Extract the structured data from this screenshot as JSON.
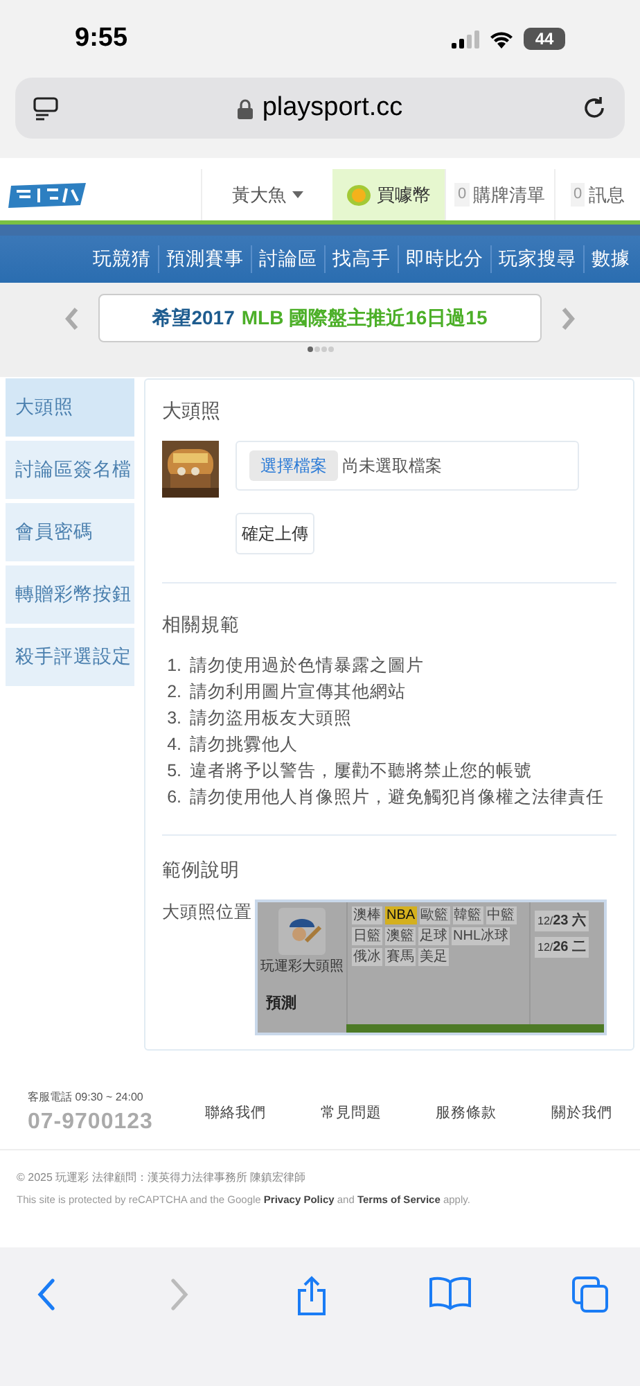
{
  "status_bar": {
    "time": "9:55",
    "battery": "44"
  },
  "browser": {
    "url": "playsport.cc"
  },
  "header": {
    "user": "黃大魚",
    "coin_button": "買噱幣",
    "cart": {
      "count": "0",
      "label": "購牌清單"
    },
    "messages": {
      "count": "0",
      "label": "訊息"
    }
  },
  "nav": [
    "玩競猜",
    "預測賽事",
    "討論區",
    "找高手",
    "即時比分",
    "玩家搜尋",
    "數據"
  ],
  "banner": {
    "prefix": "希望2017",
    "highlight": "MLB 國際盤主推近16日過15",
    "dots": [
      {
        "selected": true
      },
      {
        "selected": false
      },
      {
        "selected": false
      },
      {
        "selected": false
      }
    ]
  },
  "sidebar": [
    {
      "label": "大頭照",
      "selected": true
    },
    {
      "label": "討論區簽名檔",
      "selected": false
    },
    {
      "label": "會員密碼",
      "selected": false
    },
    {
      "label": "轉贈彩幣按鈕",
      "selected": false
    },
    {
      "label": "殺手評選設定",
      "selected": false
    }
  ],
  "avatar_section": {
    "title": "大頭照",
    "file_button": "選擇檔案",
    "file_status": "尚未選取檔案",
    "upload_button": "確定上傳"
  },
  "rules": {
    "title": "相關規範",
    "items": [
      {
        "number": "1.",
        "text": "請勿使用過於色情暴露之圖片"
      },
      {
        "number": "2.",
        "text": "請勿利用圖片宣傳其他網站"
      },
      {
        "number": "3.",
        "text": "請勿盜用板友大頭照"
      },
      {
        "number": "4.",
        "text": "請勿挑釁他人"
      },
      {
        "number": "5.",
        "text": "違者將予以警告，屢勸不聽將禁止您的帳號"
      },
      {
        "number": "6.",
        "text": "請勿使用他人肖像照片，避免觸犯肖像權之法律責任"
      }
    ]
  },
  "example": {
    "title": "範例說明",
    "label": "大頭照位置",
    "screenshot": {
      "caption": "玩運彩大頭照",
      "tags": [
        {
          "text": "澳棒",
          "selected": false
        },
        {
          "text": "NBA",
          "selected": true
        },
        {
          "text": "歐籃",
          "selected": false
        },
        {
          "text": "韓籃",
          "selected": false
        },
        {
          "text": "中籃",
          "selected": false
        },
        {
          "text": "日籃",
          "selected": false
        },
        {
          "text": "澳籃",
          "selected": false
        },
        {
          "text": "足球",
          "selected": false
        },
        {
          "text": "NHL冰球",
          "selected": false
        },
        {
          "text": "俄冰",
          "selected": false
        },
        {
          "text": "賽馬",
          "selected": false
        },
        {
          "text": "美足",
          "selected": false
        }
      ],
      "dates": [
        {
          "prefix": "12/",
          "day": "23",
          "weekday": "六"
        },
        {
          "prefix": "12/",
          "day": "26",
          "weekday": "二"
        }
      ],
      "section": "預測"
    }
  },
  "footer": {
    "hotline_label": "客服電話 09:30 ~ 24:00",
    "phone": "07-9700123",
    "links": [
      "聯絡我們",
      "常見問題",
      "服務條款",
      "關於我們"
    ],
    "copyright": "© 2025 玩運彩 法律顧問：漢英得力法律事務所 陳鎮宏律師",
    "recaptcha": "This site is protected by reCAPTCHA and the Google **Privacy Policy** and **Terms of Service** apply."
  }
}
